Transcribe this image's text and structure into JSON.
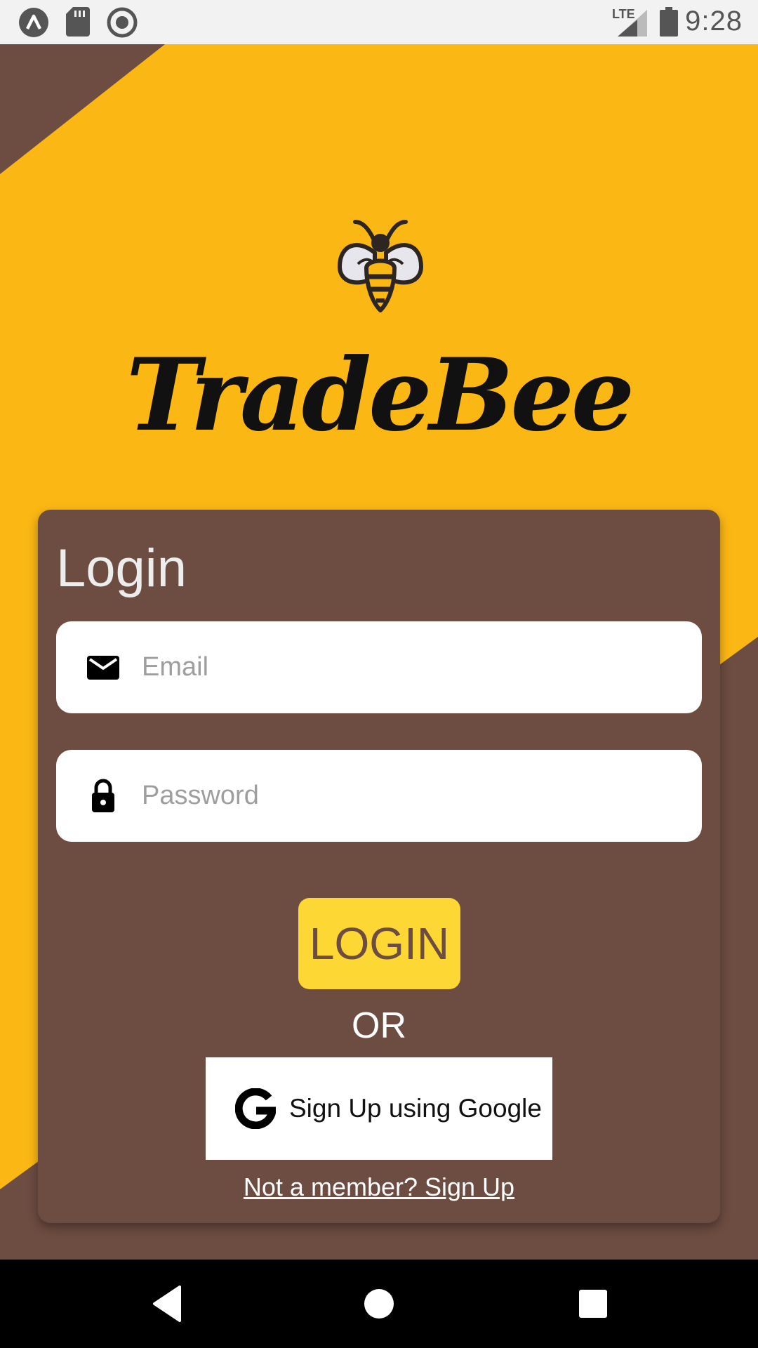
{
  "status_bar": {
    "time": "9:28",
    "network": "LTE",
    "icons": [
      "app-notification-icon",
      "sd-card-icon",
      "record-icon",
      "signal-icon",
      "battery-icon"
    ]
  },
  "app": {
    "title": "TradeBee",
    "logo_icon": "bee-icon",
    "colors": {
      "primary_yellow": "#fbb714",
      "brown": "#6d4c41",
      "button_yellow": "#fdd835"
    }
  },
  "login_card": {
    "title": "Login",
    "email": {
      "placeholder": "Email",
      "value": "",
      "icon": "mail-icon"
    },
    "password": {
      "placeholder": "Password",
      "value": "",
      "icon": "lock-icon"
    },
    "login_button": "LOGIN",
    "or_text": "OR",
    "google_button": {
      "label": "Sign Up using Google",
      "icon": "google-icon"
    },
    "signup_link": "Not a member? Sign Up"
  },
  "nav_bar": {
    "buttons": [
      "back-icon",
      "home-icon",
      "recents-icon"
    ]
  }
}
